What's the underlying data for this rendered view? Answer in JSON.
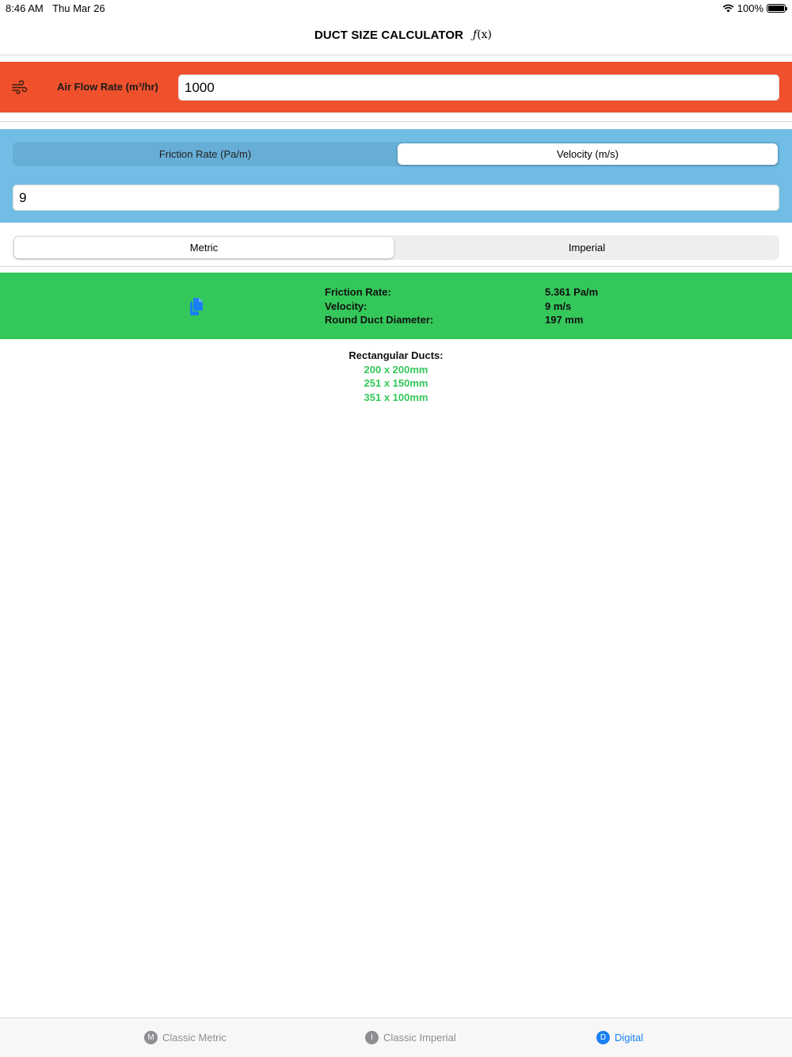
{
  "status_bar": {
    "time": "8:46 AM",
    "date": "Thu Mar 26",
    "battery": "100%",
    "wifi_icon": "wifi-icon"
  },
  "nav": {
    "title": "DUCT SIZE CALCULATOR",
    "fx_func": "ƒ",
    "fx_arg": "(x)"
  },
  "airflow": {
    "icon": "wind-icon",
    "label": "Air Flow Rate (m³/hr)",
    "value": "1000"
  },
  "rate_mode": {
    "options": [
      "Friction Rate (Pa/m)",
      "Velocity (m/s)"
    ],
    "selected": "Velocity (m/s)",
    "value": "9"
  },
  "units": {
    "options": [
      "Metric",
      "Imperial"
    ],
    "selected": "Metric"
  },
  "results": {
    "copy_icon": "copy-icon",
    "rows": [
      {
        "label": "Friction Rate:",
        "value": "5.361 Pa/m"
      },
      {
        "label": "Velocity:",
        "value": "9 m/s"
      },
      {
        "label": "Round Duct Diameter:",
        "value": "197 mm"
      }
    ]
  },
  "rectangular": {
    "title": "Rectangular Ducts:",
    "sizes": [
      "200 x 200mm",
      "251 x 150mm",
      "351 x 100mm"
    ]
  },
  "tabs": [
    {
      "badge": "M",
      "label": "Classic Metric",
      "active": false
    },
    {
      "badge": "I",
      "label": "Classic Imperial",
      "active": false
    },
    {
      "badge": "D",
      "label": "Digital",
      "active": true
    }
  ],
  "colors": {
    "airflow": "#ef512d",
    "rate_band": "#71bde6",
    "results": "#34c75a",
    "accent": "#1a7ff2"
  }
}
